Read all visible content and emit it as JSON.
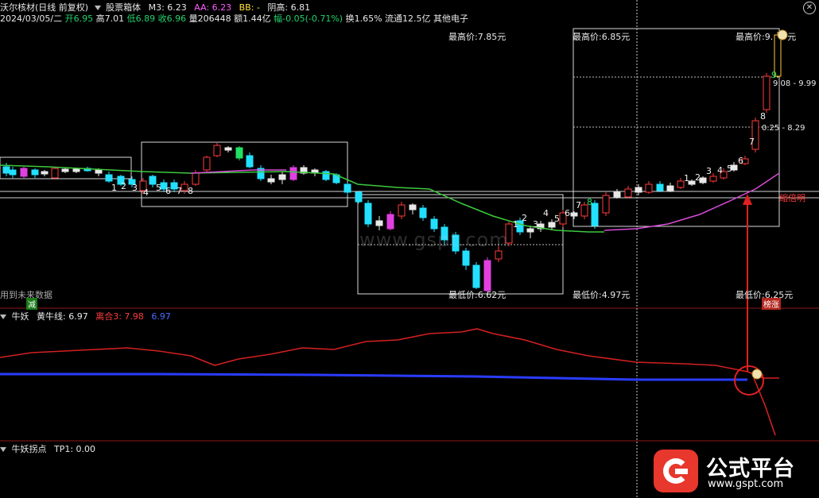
{
  "header": {
    "stock": "沃尔核材(日线 前复权)",
    "indicator": "股票箱体",
    "m3": "M3: 6.23",
    "aa": "AA: 6.23",
    "bb": "BB: -",
    "yingao": "阴高: 6.81",
    "date": "2024/03/05/二",
    "open": "开6.95",
    "high": "高7.01",
    "low": "低6.89",
    "close": "收6.96",
    "vol": "量206448",
    "amount": "额1.44亿",
    "change": "幅-0.05(-0.71%)",
    "turnover": "换1.65%",
    "float": "流通12.5亿",
    "sector": "其他电子"
  },
  "box_labels": {
    "top1": "最高价:7.85元",
    "top2": "最高价:6.85元",
    "top3": "最高价:9.",
    "top3b": "元",
    "low1": "最低价:",
    "low1b": "6.62元",
    "low2": "最低价:4.97元",
    "low3": "最低价:6.25元",
    "range_a": "9.08 - 9.99",
    "range_b": "0.25 - 8.29",
    "suoliang": "缩倍明",
    "future": "用到未来数据",
    "jian": "减",
    "bangzhang": "榜涨"
  },
  "seq_numbers": [
    "1",
    "2",
    "3",
    "4",
    "5",
    "6",
    "7",
    "8",
    "9"
  ],
  "panel2": {
    "name": "牛妖",
    "l1": "黄牛线: 6.97",
    "l2": "离合3: 7.98",
    "l3": "6.97"
  },
  "panel3": {
    "name": "牛妖拐点",
    "l1": "TP1: 0.00"
  },
  "watermark": "www.gspt.com",
  "logo": {
    "text": "公式平台",
    "url": "www.gspt.com"
  },
  "colors": {
    "bg": "#000000",
    "up": "#ff3b3b",
    "down": "#22e0ff",
    "ma_green": "#3dc93d",
    "ma_magenta": "#d94bd9",
    "box": "#d8d8d8",
    "red_line": "#d22020",
    "blue_line": "#2a3cff"
  },
  "icons": [
    "chevron-down-icon",
    "close-icon",
    "moneybag-icon",
    "arrow-up-icon"
  ]
}
